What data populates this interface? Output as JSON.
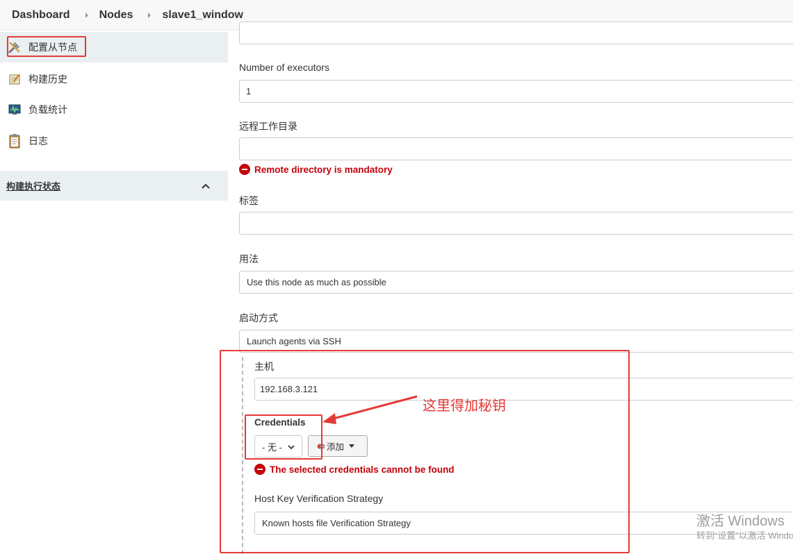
{
  "breadcrumb": {
    "items": [
      "Dashboard",
      "Nodes",
      "slave1_window"
    ]
  },
  "sidebar": {
    "items": [
      {
        "label": "配置从节点",
        "icon": "configure-icon"
      },
      {
        "label": "构建历史",
        "icon": "notepad-icon"
      },
      {
        "label": "负载统计",
        "icon": "monitor-icon"
      },
      {
        "label": "日志",
        "icon": "clipboard-icon"
      }
    ],
    "executor_status": {
      "title": "构建执行状态",
      "icon": "chevron-up-icon"
    }
  },
  "form": {
    "executors": {
      "label": "Number of executors",
      "value": "1"
    },
    "remote_dir": {
      "label": "远程工作目录",
      "value": "",
      "error": "Remote directory is mandatory"
    },
    "labels": {
      "label": "标签",
      "value": ""
    },
    "usage": {
      "label": "用法",
      "value": "Use this node as much as possible"
    },
    "launch": {
      "label": "启动方式",
      "value": "Launch agents via SSH"
    },
    "host": {
      "label": "主机",
      "value": "192.168.3.121"
    },
    "credentials": {
      "label": "Credentials",
      "selected": "- 无 -",
      "add_label": "添加",
      "error": "The selected credentials cannot be found"
    },
    "host_key": {
      "label": "Host Key Verification Strategy",
      "value": "Known hosts file Verification Strategy"
    }
  },
  "annotation": {
    "text": "这里得加秘钥"
  },
  "watermark": {
    "line1": "激活 Windows",
    "line2": "转到“设置”以激活 Windows。"
  },
  "colors": {
    "annotation_red": "#e53935",
    "error_red": "#c4000a",
    "sidebar_active": "#eaeff2"
  }
}
